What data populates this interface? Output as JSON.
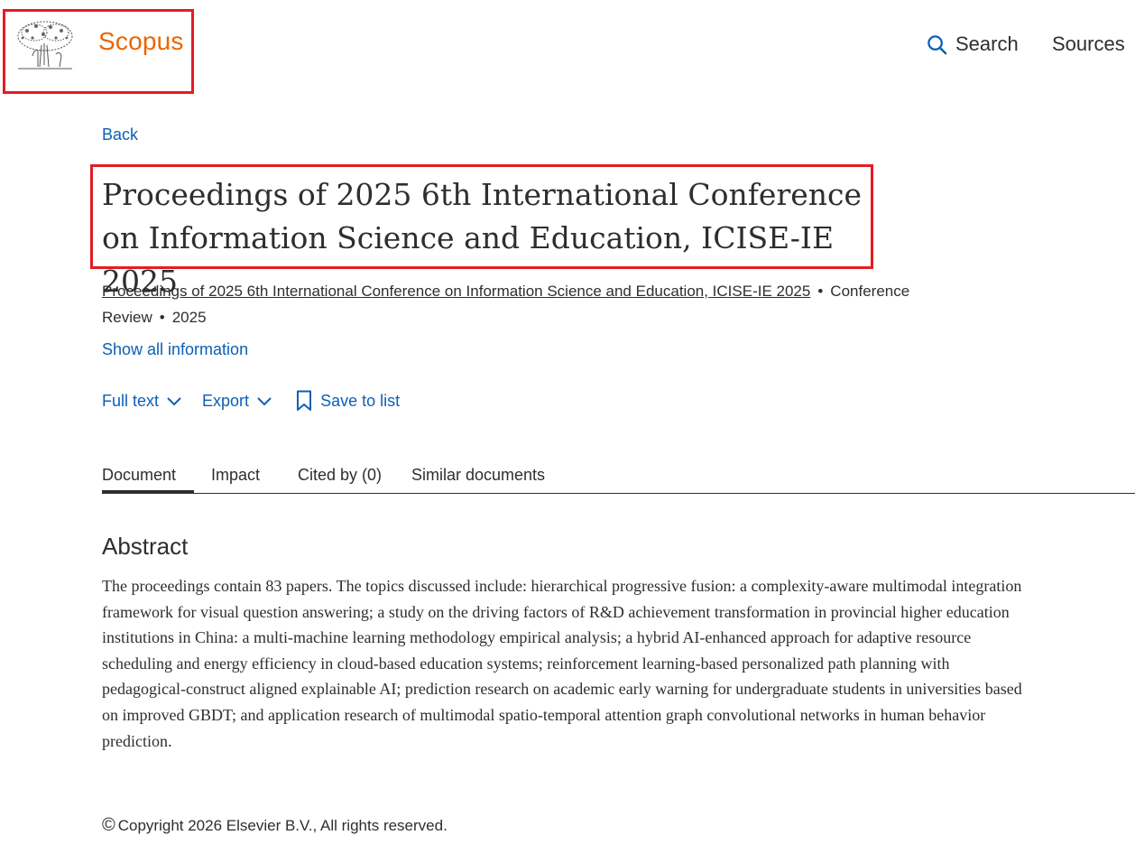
{
  "header": {
    "logo_text": "Scopus",
    "nav": {
      "search_label": "Search",
      "sources_label": "Sources"
    }
  },
  "back_label": "Back",
  "document": {
    "title": "Proceedings of 2025 6th International Conference on Information Science and Education, ICISE-IE 2025",
    "source_title": "Proceedings of 2025 6th International Conference on Information Science and Education, ICISE-IE 2025",
    "doc_type": "Conference Review",
    "year": "2025",
    "separator": "•",
    "show_all_label": "Show all information"
  },
  "actions": {
    "full_text_label": "Full text",
    "export_label": "Export",
    "save_label": "Save to list"
  },
  "tabs": [
    {
      "label": "Document",
      "active": true
    },
    {
      "label": "Impact",
      "active": false
    },
    {
      "label": "Cited by (0)",
      "active": false
    },
    {
      "label": "Similar documents",
      "active": false
    }
  ],
  "abstract": {
    "heading": "Abstract",
    "text": "The proceedings contain 83 papers. The topics discussed include: hierarchical progressive fusion: a complexity-aware multimodal integration framework for visual question answering; a study on the driving factors of R&D achievement transformation in provincial higher education institutions in China: a multi-machine learning methodology empirical analysis; a hybrid AI-enhanced approach for adaptive resource scheduling and energy efficiency in cloud-based education systems; reinforcement learning-based personalized path planning with pedagogical-construct aligned explainable AI; prediction research on academic early warning for undergraduate students in universities based on improved GBDT; and application research of multimodal spatio-temporal attention graph convolutional networks in human behavior prediction."
  },
  "footer": {
    "copyright_symbol": "©",
    "copyright_text": "Copyright 2026 Elsevier B.V., All rights reserved."
  },
  "colors": {
    "brand": "#eb6500",
    "link": "#0c60b5",
    "highlight": "#e51c23",
    "text": "#2e2e2e"
  },
  "icons": {
    "logo": "elsevier-tree-icon",
    "search": "search-icon",
    "chevron": "chevron-down-icon",
    "bookmark": "bookmark-icon"
  }
}
